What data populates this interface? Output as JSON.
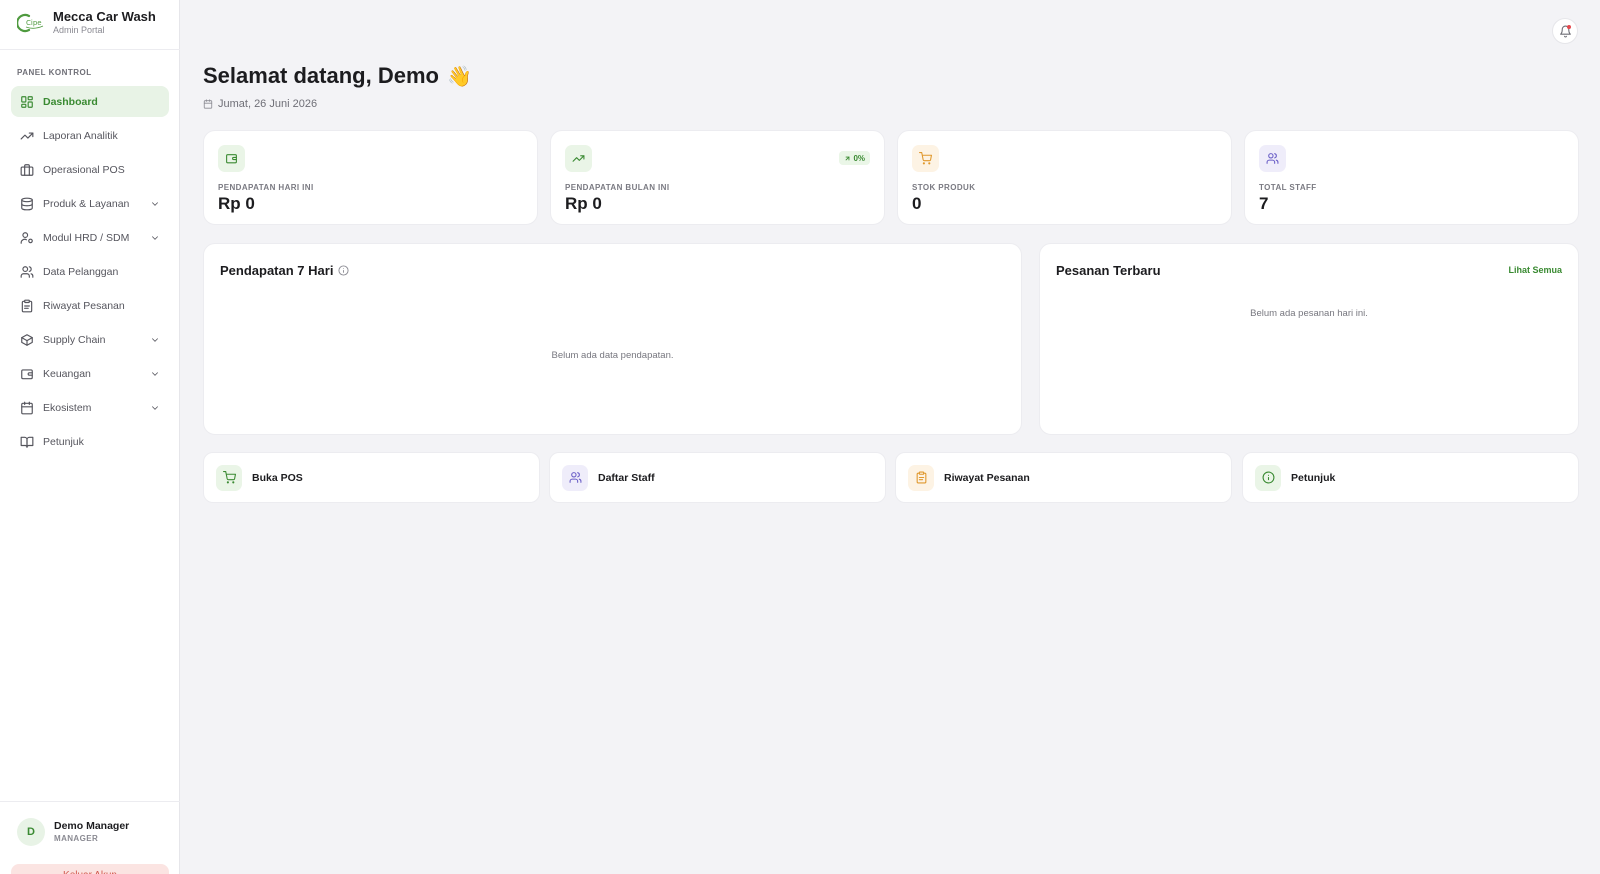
{
  "brand": {
    "title": "Mecca Car Wash",
    "subtitle": "Admin Portal",
    "logo_text": "Cipe"
  },
  "colors": {
    "accent": "#3a8a32",
    "accent_bg": "#e8f3e6",
    "orange": "#e0982d",
    "purple": "#6b5fc7",
    "danger": "#d2574c"
  },
  "sidebar": {
    "section_label": "PANEL KONTROL",
    "items": [
      {
        "label": "Dashboard",
        "icon": "dashboard-grid-icon",
        "active": true,
        "expandable": false
      },
      {
        "label": "Laporan Analitik",
        "icon": "trending-up-icon",
        "active": false,
        "expandable": false
      },
      {
        "label": "Operasional POS",
        "icon": "briefcase-icon",
        "active": false,
        "expandable": false
      },
      {
        "label": "Produk & Layanan",
        "icon": "database-icon",
        "active": false,
        "expandable": true
      },
      {
        "label": "Modul HRD / SDM",
        "icon": "user-cog-icon",
        "active": false,
        "expandable": true
      },
      {
        "label": "Data Pelanggan",
        "icon": "users-icon",
        "active": false,
        "expandable": false
      },
      {
        "label": "Riwayat Pesanan",
        "icon": "clipboard-icon",
        "active": false,
        "expandable": false
      },
      {
        "label": "Supply Chain",
        "icon": "box-icon",
        "active": false,
        "expandable": true
      },
      {
        "label": "Keuangan",
        "icon": "wallet-icon",
        "active": false,
        "expandable": true
      },
      {
        "label": "Ekosistem",
        "icon": "calendar-icon",
        "active": false,
        "expandable": true
      },
      {
        "label": "Petunjuk",
        "icon": "book-icon",
        "active": false,
        "expandable": false
      }
    ],
    "user": {
      "initial": "D",
      "name": "Demo Manager",
      "role": "MANAGER"
    },
    "logout_label": "Keluar Akun"
  },
  "header": {
    "greeting": "Selamat datang, Demo",
    "wave": "👋",
    "date": "Jumat, 26 Juni 2026"
  },
  "stats": [
    {
      "label": "PENDAPATAN HARI INI",
      "value": "Rp 0",
      "icon": "wallet-icon"
    },
    {
      "label": "PENDAPATAN BULAN INI",
      "value": "Rp 0",
      "icon": "trending-up-icon",
      "trend": "0%"
    },
    {
      "label": "STOK PRODUK",
      "value": "0",
      "icon": "cart-icon"
    },
    {
      "label": "TOTAL STAFF",
      "value": "7",
      "icon": "users-icon"
    }
  ],
  "revenue_panel": {
    "title": "Pendapatan 7 Hari",
    "empty": "Belum ada data pendapatan."
  },
  "orders_panel": {
    "title": "Pesanan Terbaru",
    "see_all": "Lihat Semua",
    "empty": "Belum ada pesanan hari ini."
  },
  "quick_links": [
    {
      "label": "Buka POS",
      "icon": "cart-icon"
    },
    {
      "label": "Daftar Staff",
      "icon": "users-icon"
    },
    {
      "label": "Riwayat Pesanan",
      "icon": "clipboard-icon"
    },
    {
      "label": "Petunjuk",
      "icon": "info-icon"
    }
  ]
}
